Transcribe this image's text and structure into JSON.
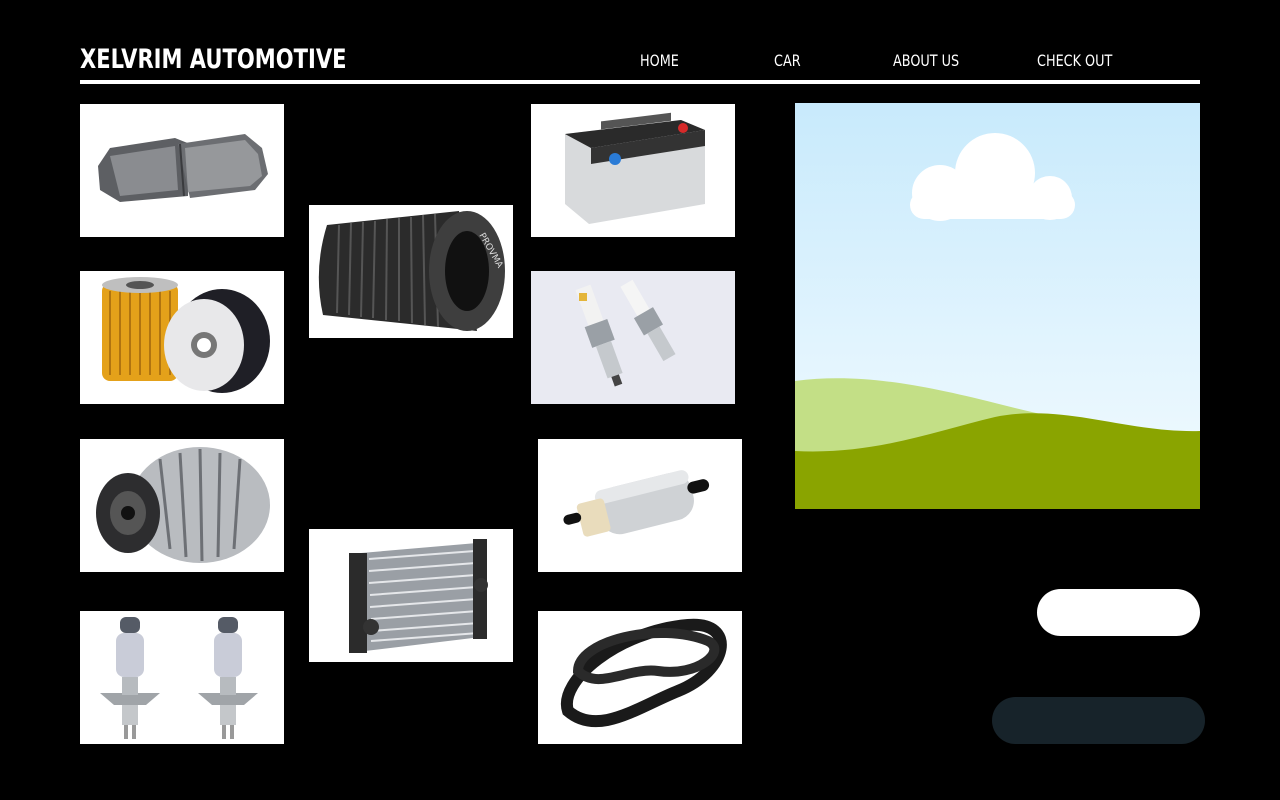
{
  "header": {
    "brand": "XELVRIM AUTOMOTIVE",
    "nav": [
      {
        "label": "HOME"
      },
      {
        "label": "CAR"
      },
      {
        "label": "ABOUT US"
      },
      {
        "label": "CHECK OUT"
      }
    ]
  },
  "products": [
    {
      "name": "brake-pads"
    },
    {
      "name": "air-filter"
    },
    {
      "name": "car-battery"
    },
    {
      "name": "oil-filters"
    },
    {
      "name": "spark-plugs"
    },
    {
      "name": "alternator"
    },
    {
      "name": "fuel-pump"
    },
    {
      "name": "radiator"
    },
    {
      "name": "headlight-bulbs"
    },
    {
      "name": "timing-belt"
    }
  ],
  "air_filter_brand": "PROVMA",
  "hero": {
    "image": "sky-landscape-placeholder"
  },
  "colors": {
    "background": "#000000",
    "text": "#ffffff",
    "dark_button": "#17232a",
    "grass": "#8aa400",
    "sky": "#c8eafc"
  }
}
